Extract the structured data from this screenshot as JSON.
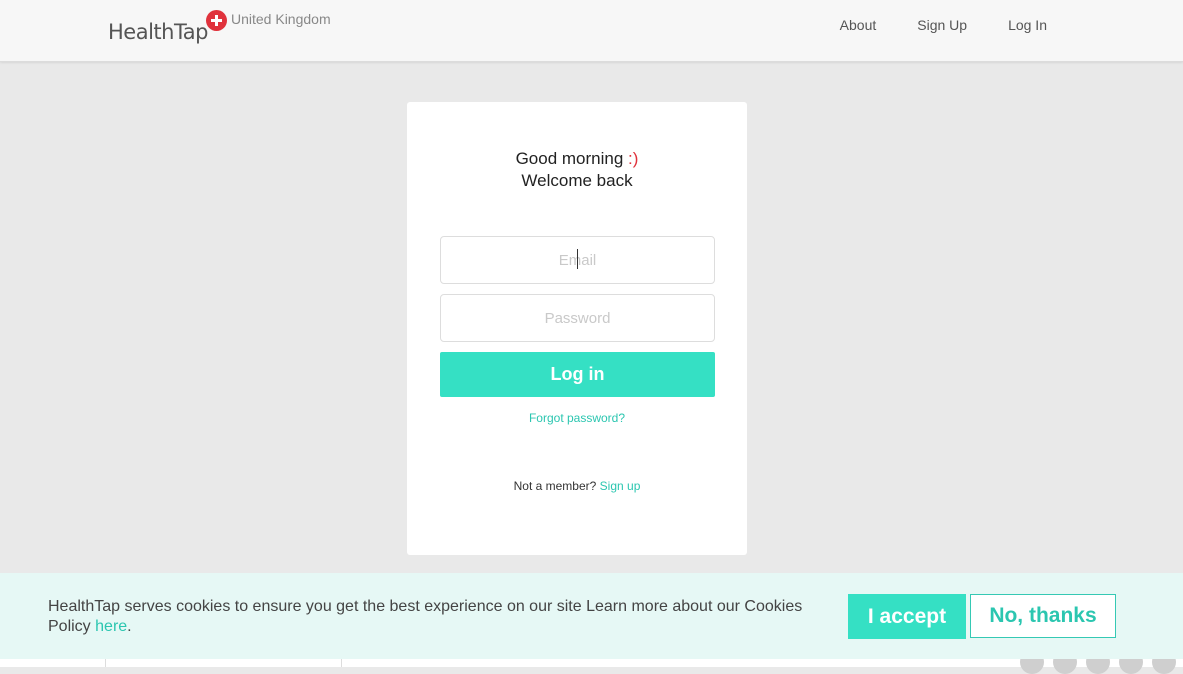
{
  "header": {
    "logo_text": "HealthTap",
    "region": "United Kingdom",
    "nav": [
      {
        "label": "About"
      },
      {
        "label": "Sign Up"
      },
      {
        "label": "Log In"
      }
    ]
  },
  "login": {
    "greeting": "Good morning",
    "smiley": ":)",
    "welcome": "Welcome back",
    "email_placeholder": "Email",
    "password_placeholder": "Password",
    "login_button": "Log in",
    "forgot_password": "Forgot password?",
    "not_member": "Not a member?",
    "sign_up_link": "Sign up"
  },
  "cookie_banner": {
    "text": "HealthTap serves cookies to ensure you get the best experience on our site Learn more about our Cookies Policy",
    "link": "here",
    "link_suffix": ".",
    "accept": "I accept",
    "decline": "No, thanks"
  },
  "colors": {
    "brand_red": "#e0323c",
    "accent_teal": "#35e0c4",
    "link_teal": "#2bc6b0"
  }
}
